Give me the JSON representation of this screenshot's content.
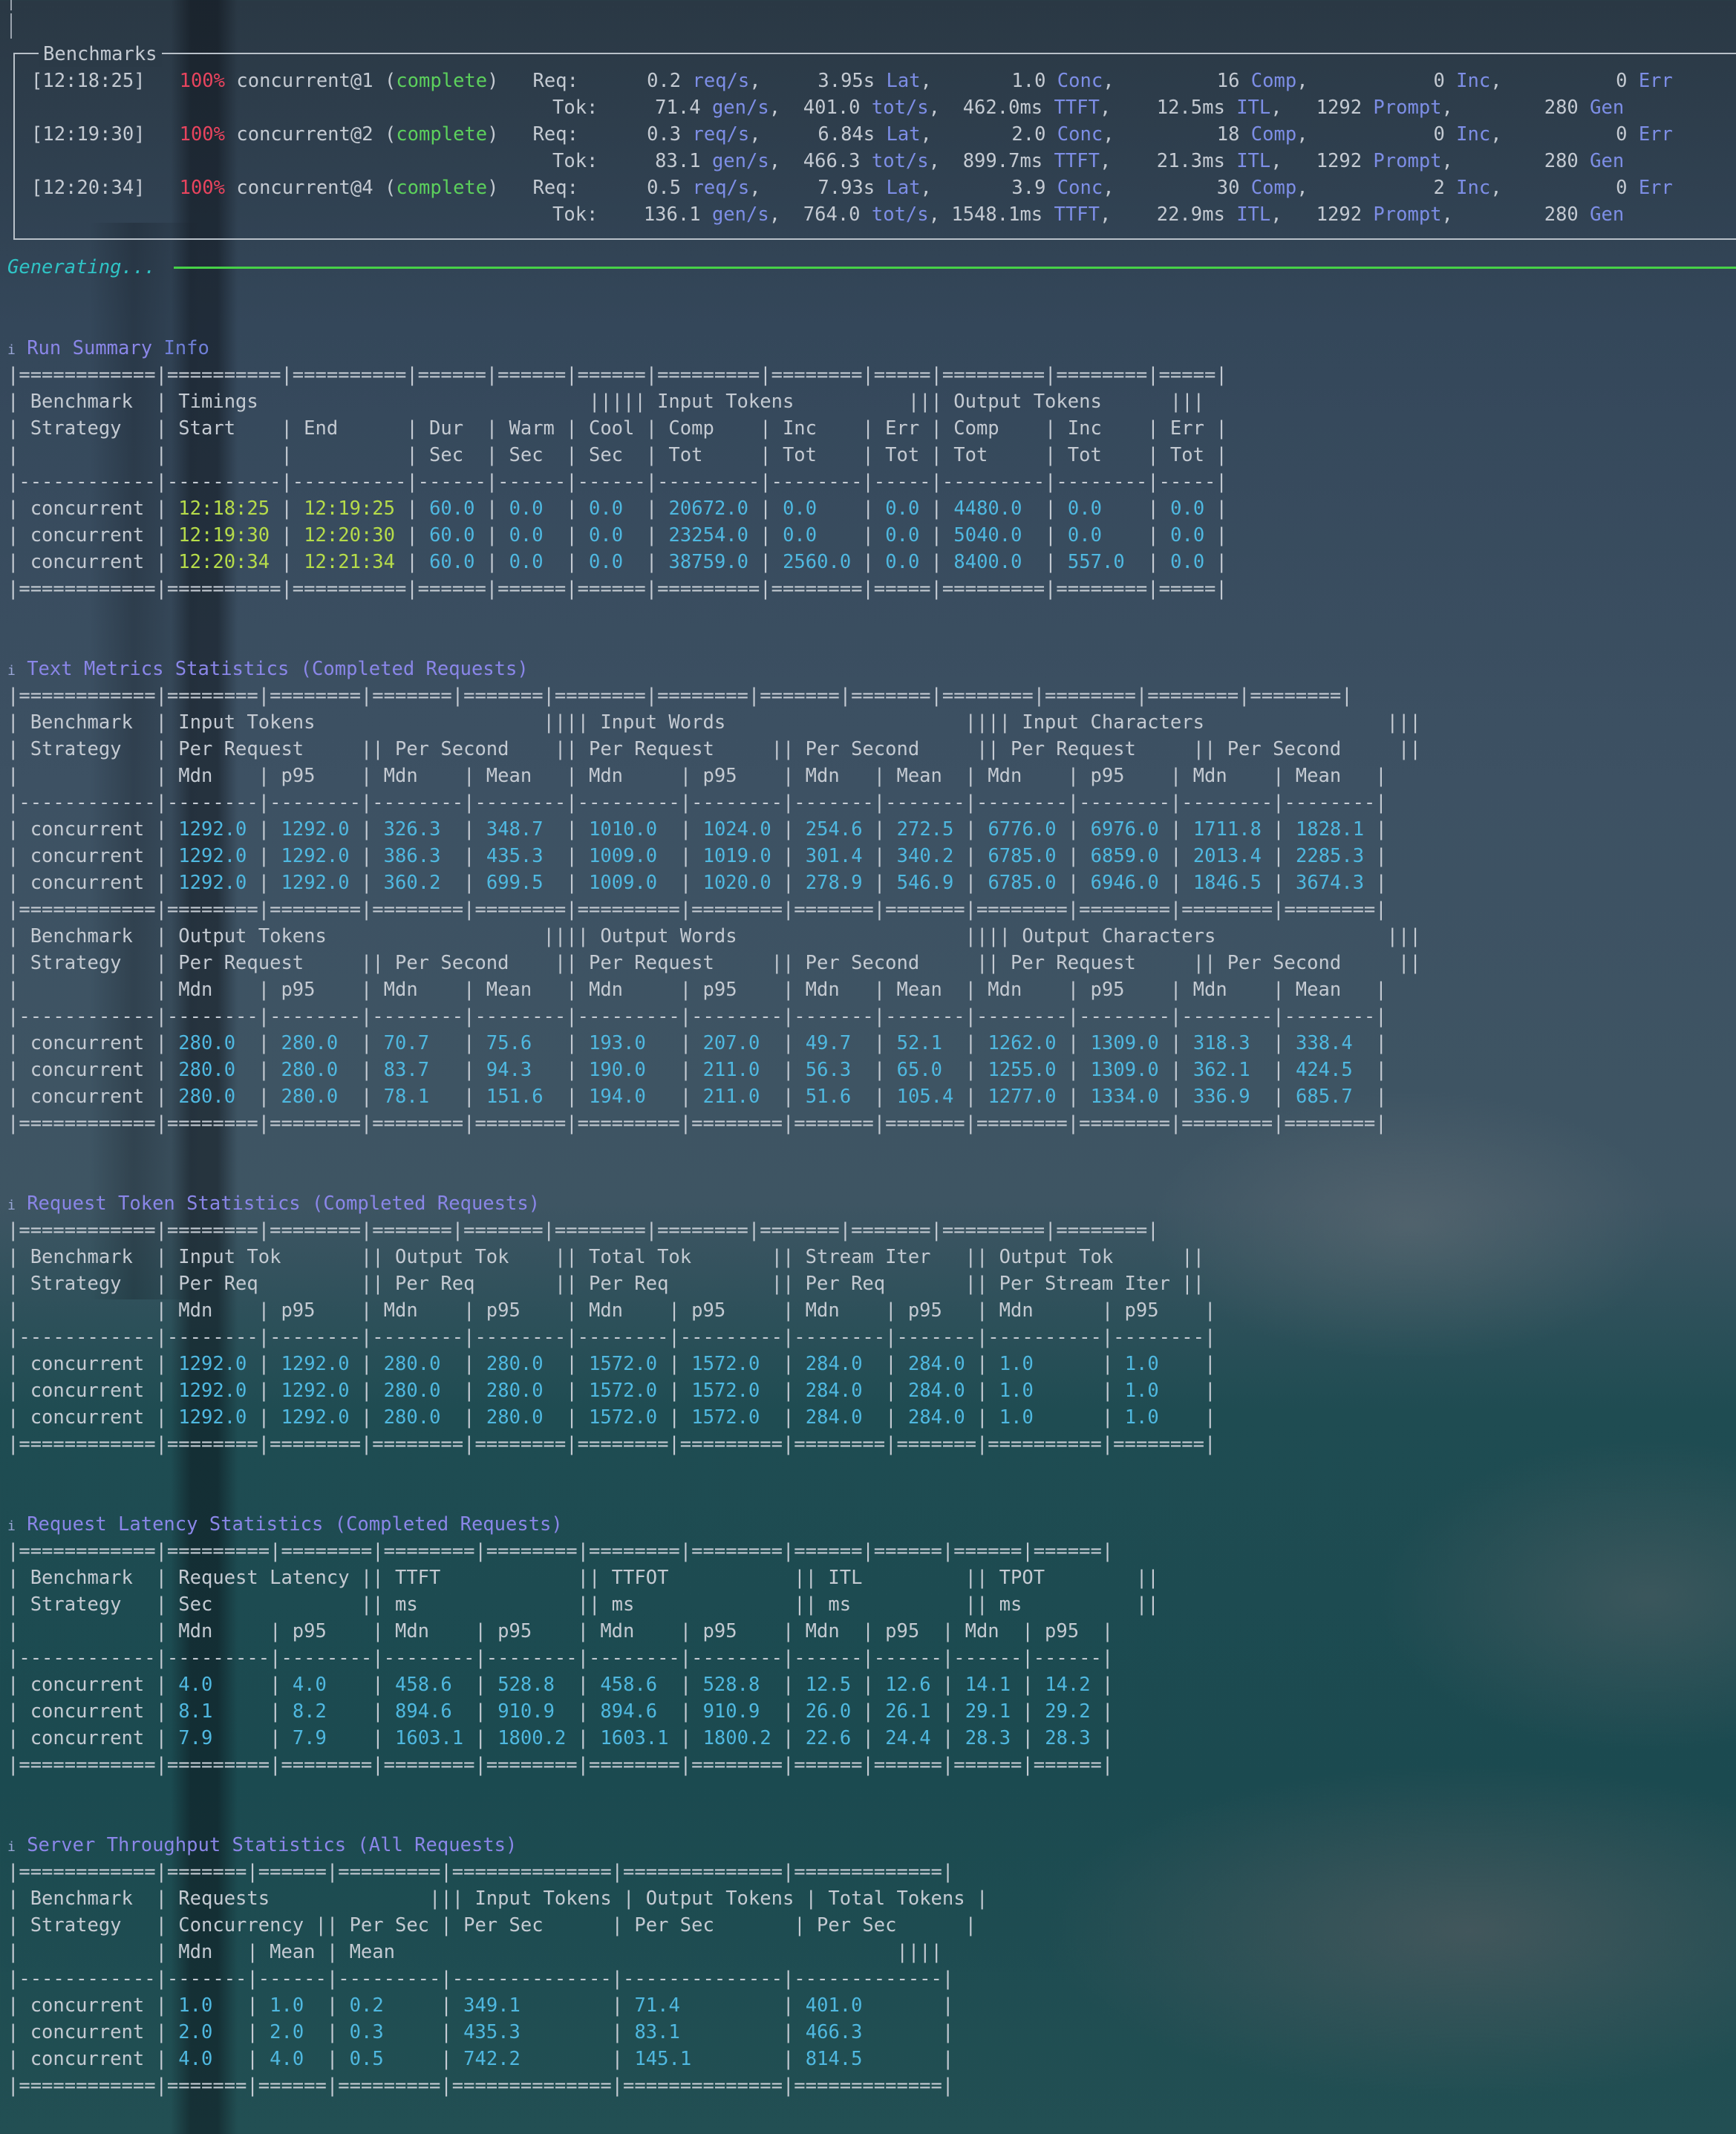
{
  "benchmarks_panel": {
    "title": "Benchmarks",
    "rows": [
      {
        "time": "[12:18:25]",
        "pct": "100%",
        "name": "concurrent@1",
        "status": "complete",
        "req": {
          "rate": "0.2",
          "lat": "3.95s",
          "conc": "1.0",
          "comp": "16",
          "inc": "0",
          "err": "0"
        },
        "tok": {
          "gen": "71.4",
          "tot": "401.0",
          "ttft": "462.0ms",
          "itl": "12.5ms",
          "prompt": "1292",
          "gen_count": "280"
        }
      },
      {
        "time": "[12:19:30]",
        "pct": "100%",
        "name": "concurrent@2",
        "status": "complete",
        "req": {
          "rate": "0.3",
          "lat": "6.84s",
          "conc": "2.0",
          "comp": "18",
          "inc": "0",
          "err": "0"
        },
        "tok": {
          "gen": "83.1",
          "tot": "466.3",
          "ttft": "899.7ms",
          "itl": "21.3ms",
          "prompt": "1292",
          "gen_count": "280"
        }
      },
      {
        "time": "[12:20:34]",
        "pct": "100%",
        "name": "concurrent@4",
        "status": "complete",
        "req": {
          "rate": "0.5",
          "lat": "7.93s",
          "conc": "3.9",
          "comp": "30",
          "inc": "2",
          "err": "0"
        },
        "tok": {
          "gen": "136.1",
          "tot": "764.0",
          "ttft": "1548.1ms",
          "itl": "22.9ms",
          "prompt": "1292",
          "gen_count": "280"
        }
      }
    ]
  },
  "generating_label": "Generating...",
  "sections": [
    {
      "title": "Run Summary",
      "suffix": "Info",
      "lines": [
        "|============|==========|==========|======|======|======|=========|========|=====|=========|========|=====|",
        "| Benchmark  | Timings                             ||||| Input Tokens          ||| Output Tokens      |||",
        "| Strategy   | Start    | End      | Dur  | Warm | Cool | Comp    | Inc    | Err | Comp    | Inc    | Err |",
        "|            |          |          | Sec  | Sec  | Sec  | Tot     | Tot    | Tot | Tot     | Tot    | Tot |",
        "|------------|----------|----------|------|------|------|---------|--------|-----|---------|--------|-----|",
        "| concurrent | 12:18:25 | 12:19:25 | 60.0 | 0.0  | 0.0  | 20672.0 | 0.0    | 0.0 | 4480.0  | 0.0    | 0.0 |",
        "| concurrent | 12:19:30 | 12:20:30 | 60.0 | 0.0  | 0.0  | 23254.0 | 0.0    | 0.0 | 5040.0  | 0.0    | 0.0 |",
        "| concurrent | 12:20:34 | 12:21:34 | 60.0 | 0.0  | 0.0  | 38759.0 | 2560.0 | 0.0 | 8400.0  | 557.0  | 0.0 |",
        "|============|==========|==========|======|======|======|=========|========|=====|=========|========|=====|"
      ]
    },
    {
      "title": "Text Metrics Statistics (Completed Requests)",
      "suffix": "",
      "lines": [
        "|============|========|========|=======|=======|========|========|=======|=======|========|========|========|========|",
        "| Benchmark  | Input Tokens                    |||| Input Words                     |||| Input Characters                |||",
        "| Strategy   | Per Request     || Per Second    || Per Request     || Per Second     || Per Request     || Per Second     ||",
        "|            | Mdn    | p95    | Mdn    | Mean   | Mdn     | p95    | Mdn   | Mean  | Mdn    | p95    | Mdn    | Mean   |",
        "|------------|--------|--------|--------|--------|---------|--------|-------|-------|--------|--------|--------|--------|",
        "| concurrent | 1292.0 | 1292.0 | 326.3  | 348.7  | 1010.0  | 1024.0 | 254.6 | 272.5 | 6776.0 | 6976.0 | 1711.8 | 1828.1 |",
        "| concurrent | 1292.0 | 1292.0 | 386.3  | 435.3  | 1009.0  | 1019.0 | 301.4 | 340.2 | 6785.0 | 6859.0 | 2013.4 | 2285.3 |",
        "| concurrent | 1292.0 | 1292.0 | 360.2  | 699.5  | 1009.0  | 1020.0 | 278.9 | 546.9 | 6785.0 | 6946.0 | 1846.5 | 3674.3 |",
        "|============|========|========|========|========|=========|========|=======|=======|========|========|========|========|",
        "| Benchmark  | Output Tokens                   |||| Output Words                    |||| Output Characters               |||",
        "| Strategy   | Per Request     || Per Second    || Per Request     || Per Second     || Per Request     || Per Second     ||",
        "|            | Mdn    | p95    | Mdn    | Mean   | Mdn     | p95    | Mdn   | Mean  | Mdn    | p95    | Mdn    | Mean   |",
        "|------------|--------|--------|--------|--------|---------|--------|-------|-------|--------|--------|--------|--------|",
        "| concurrent | 280.0  | 280.0  | 70.7   | 75.6   | 193.0   | 207.0  | 49.7  | 52.1  | 1262.0 | 1309.0 | 318.3  | 338.4  |",
        "| concurrent | 280.0  | 280.0  | 83.7   | 94.3   | 190.0   | 211.0  | 56.3  | 65.0  | 1255.0 | 1309.0 | 362.1  | 424.5  |",
        "| concurrent | 280.0  | 280.0  | 78.1   | 151.6  | 194.0   | 211.0  | 51.6  | 105.4 | 1277.0 | 1334.0 | 336.9  | 685.7  |",
        "|============|========|========|========|========|=========|========|=======|=======|========|========|========|========|"
      ]
    },
    {
      "title": "Request Token Statistics (Completed Requests)",
      "suffix": "",
      "lines": [
        "|============|========|========|=======|=======|========|========|=======|=======|=========|========|",
        "| Benchmark  | Input Tok       || Output Tok    || Total Tok       || Stream Iter   || Output Tok      ||",
        "| Strategy   | Per Req         || Per Req       || Per Req         || Per Req       || Per Stream Iter ||",
        "|            | Mdn    | p95    | Mdn    | p95    | Mdn    | p95     | Mdn    | p95   | Mdn      | p95    |",
        "|------------|--------|--------|--------|--------|--------|---------|--------|-------|----------|--------|",
        "| concurrent | 1292.0 | 1292.0 | 280.0  | 280.0  | 1572.0 | 1572.0  | 284.0  | 284.0 | 1.0      | 1.0    |",
        "| concurrent | 1292.0 | 1292.0 | 280.0  | 280.0  | 1572.0 | 1572.0  | 284.0  | 284.0 | 1.0      | 1.0    |",
        "| concurrent | 1292.0 | 1292.0 | 280.0  | 280.0  | 1572.0 | 1572.0  | 284.0  | 284.0 | 1.0      | 1.0    |",
        "|============|========|========|========|========|========|=========|========|=======|==========|========|"
      ]
    },
    {
      "title": "Request Latency Statistics (Completed Requests)",
      "suffix": "",
      "lines": [
        "|============|=========|========|========|========|========|========|======|======|======|======|",
        "| Benchmark  | Request Latency || TTFT            || TTFOT           || ITL         || TPOT        ||",
        "| Strategy   | Sec             || ms              || ms              || ms          || ms          ||",
        "|            | Mdn     | p95    | Mdn    | p95    | Mdn    | p95    | Mdn  | p95  | Mdn  | p95  |",
        "|------------|---------|--------|--------|--------|--------|--------|------|------|------|------|",
        "| concurrent | 4.0     | 4.0    | 458.6  | 528.8  | 458.6  | 528.8  | 12.5 | 12.6 | 14.1 | 14.2 |",
        "| concurrent | 8.1     | 8.2    | 894.6  | 910.9  | 894.6  | 910.9  | 26.0 | 26.1 | 29.1 | 29.2 |",
        "| concurrent | 7.9     | 7.9    | 1603.1 | 1800.2 | 1603.1 | 1800.2 | 22.6 | 24.4 | 28.3 | 28.3 |",
        "|============|=========|========|========|========|========|========|======|======|======|======|"
      ]
    },
    {
      "title": "Server Throughput Statistics (All Requests)",
      "suffix": "",
      "lines": [
        "|============|=======|======|=========|==============|==============|=============|",
        "| Benchmark  | Requests              ||| Input Tokens | Output Tokens | Total Tokens |",
        "| Strategy   | Concurrency || Per Sec | Per Sec      | Per Sec       | Per Sec      |",
        "|            | Mdn   | Mean | Mean                                            ||||",
        "|------------|-------|------|---------|--------------|--------------|-------------|",
        "| concurrent | 1.0   | 1.0  | 0.2     | 349.1        | 71.4         | 401.0       |",
        "| concurrent | 2.0   | 2.0  | 0.3     | 435.3        | 83.1         | 466.3       |",
        "| concurrent | 4.0   | 4.0  | 0.5     | 742.2        | 145.1        | 814.5       |",
        "|============|=======|======|=========|==============|==============|=============|"
      ]
    }
  ],
  "colors": {
    "cyan": "#4fb8e0",
    "green": "#5cd05c",
    "red": "#e8445e",
    "yellow": "#b6dc4a",
    "blue": "#7d8ee6",
    "header": "#8a86e8"
  },
  "icons": {
    "section_marker": "info-icon"
  }
}
